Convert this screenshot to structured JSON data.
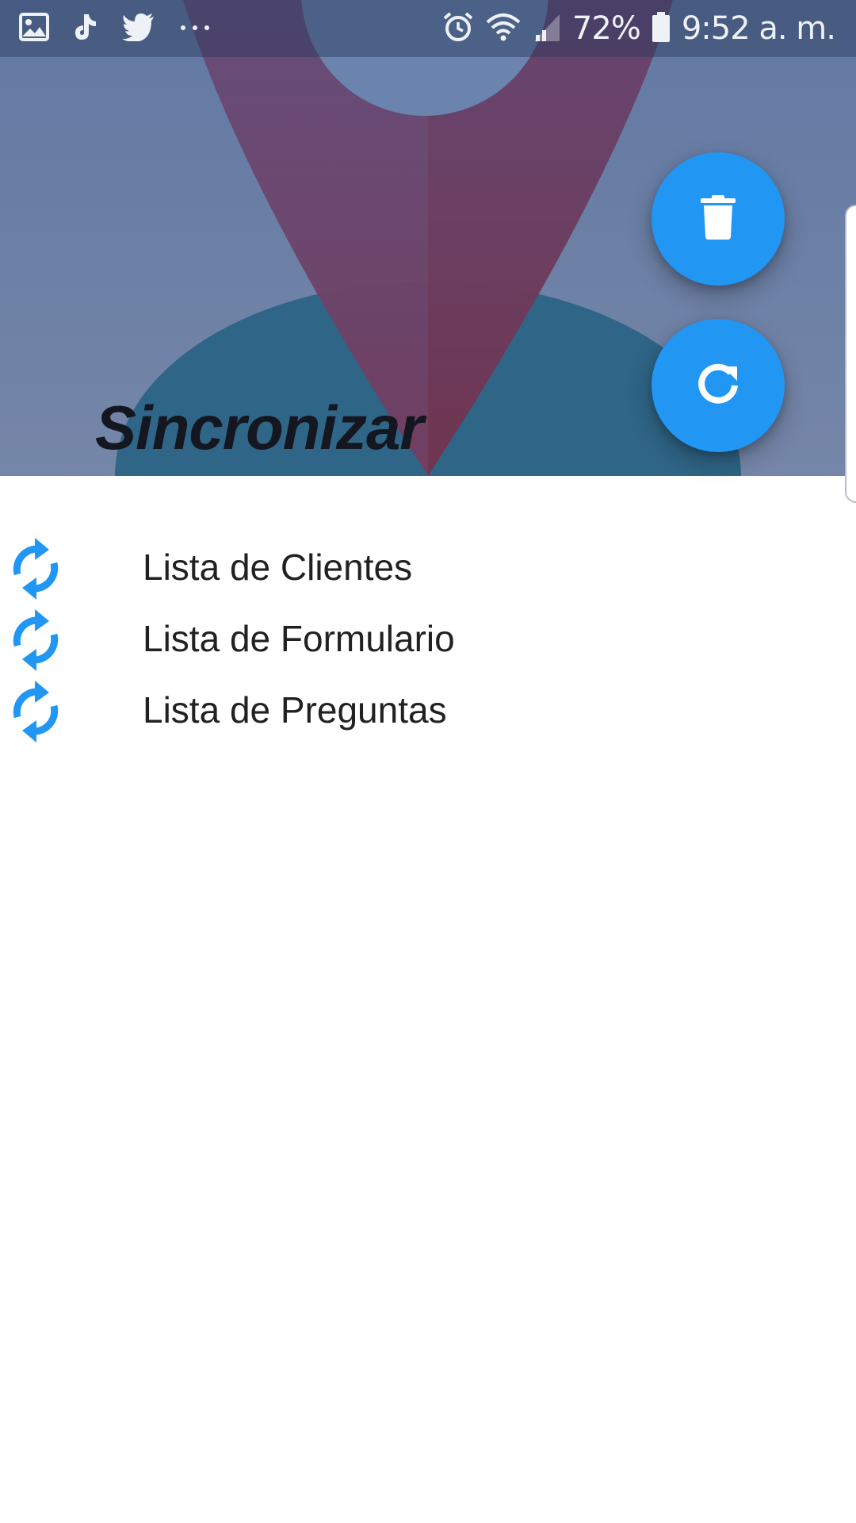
{
  "status_bar": {
    "left_icons": [
      "gallery-icon",
      "tiktok-icon",
      "twitter-icon",
      "more-dots-icon"
    ],
    "right_icons": [
      "alarm-icon",
      "wifi-icon",
      "signal-icon",
      "battery-icon"
    ],
    "battery": "72%",
    "time": "9:52 a. m."
  },
  "header": {
    "title": "Sincronizar"
  },
  "fabs": [
    {
      "name": "delete",
      "icon": "trash-icon"
    },
    {
      "name": "refresh",
      "icon": "refresh-icon"
    }
  ],
  "list": {
    "items": [
      {
        "label": "Lista de Clientes",
        "icon": "sync-icon"
      },
      {
        "label": "Lista de Formulario",
        "icon": "sync-icon"
      },
      {
        "label": "Lista de Preguntas",
        "icon": "sync-icon"
      }
    ]
  },
  "colors": {
    "accent": "#2196f3",
    "header_bg": "#6b81a8",
    "pin": "#6b3d63",
    "ellipse": "#2f6586",
    "text": "#212121"
  }
}
